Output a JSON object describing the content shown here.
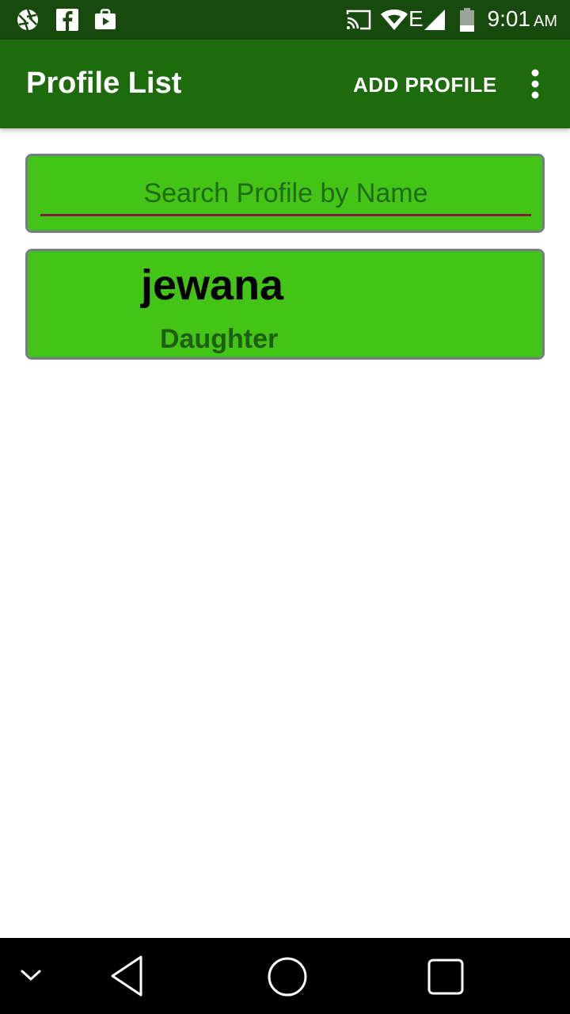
{
  "status_bar": {
    "time": "9:01",
    "ampm": "AM",
    "icons": [
      "aperture-icon",
      "facebook-icon",
      "store-bag-icon",
      "cast-icon",
      "wifi-icon",
      "network-e-icon",
      "signal-icon",
      "battery-icon"
    ],
    "network_type": "E"
  },
  "app_bar": {
    "title": "Profile List",
    "add_profile_label": "ADD PROFILE",
    "overflow_icon": "more-vert-icon",
    "color": "#1e6b0e"
  },
  "search": {
    "placeholder": "Search Profile by Name",
    "value": ""
  },
  "profiles": [
    {
      "name": "jewana",
      "relation": "Daughter"
    }
  ],
  "nav_bar": {
    "icons": [
      "chevron-down-icon",
      "back-icon",
      "home-icon",
      "recents-icon"
    ]
  },
  "colors": {
    "status_bar": "#174a0c",
    "card_green": "#43c416",
    "card_border": "#777c88",
    "underline": "#7a1f3a"
  }
}
